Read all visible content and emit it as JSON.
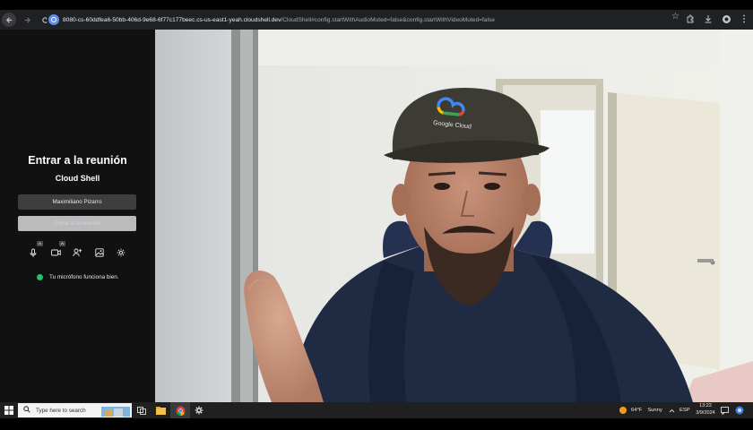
{
  "browser": {
    "url_host": "8080-cs-60ddfea6-50bb-406d-9e68-6f77c177beec.cs-us-east1-yeah.cloudshell.dev",
    "url_rest": "/CloudShell#config.startWithAudioMuted=false&config.startWithVideoMuted=false"
  },
  "prejoin": {
    "title": "Entrar a la reunión",
    "room_name": "Cloud Shell",
    "name_value": "Maximiliano Pizarro",
    "join_label": "Entrar a la reunión",
    "mic_status": "Tu micrófono funciona bien.",
    "status_color": "#1ec36a"
  },
  "video": {
    "cap_logo_text": "Google Cloud"
  },
  "taskbar": {
    "search_placeholder": "Type here to search",
    "weather_temp": "64°F",
    "weather_desc": "Sunny",
    "language": "ESP",
    "time": "13:22",
    "date": "3/9/2024"
  }
}
